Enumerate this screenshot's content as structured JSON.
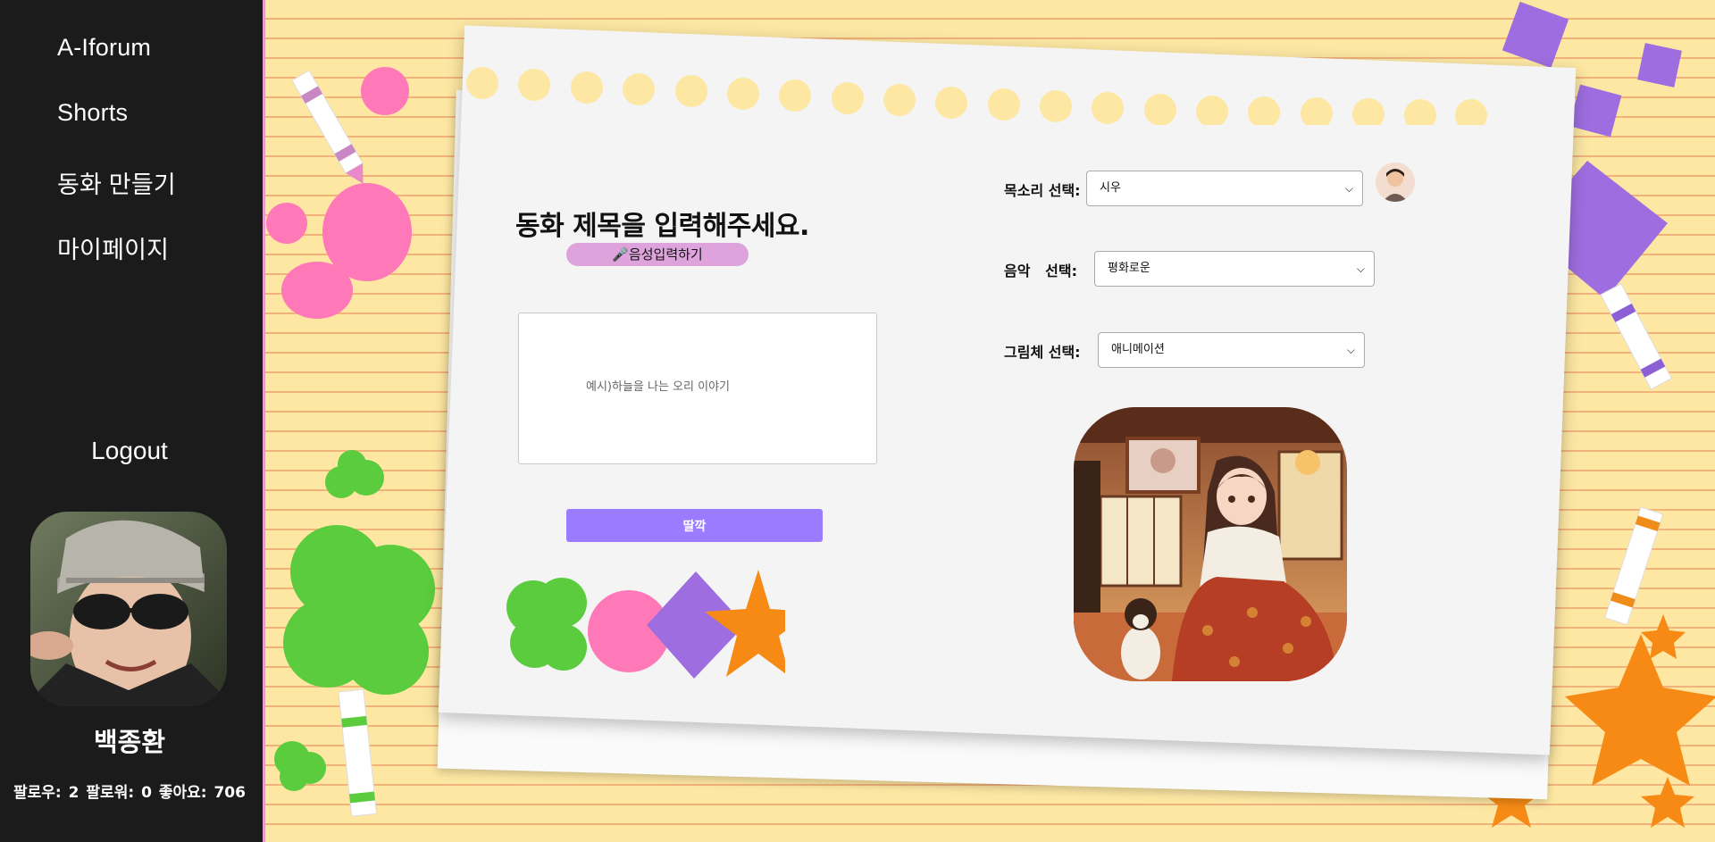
{
  "sidebar": {
    "nav": [
      {
        "label": "A-Iforum"
      },
      {
        "label": "Shorts"
      },
      {
        "label": "동화 만들기"
      },
      {
        "label": "마이페이지"
      }
    ],
    "logout_label": "Logout",
    "user": {
      "name": "백종환",
      "followers_label": "팔로우:",
      "followers": "2",
      "following_label": "팔로워:",
      "following": "0",
      "likes_label": "좋아요:",
      "likes": "706"
    }
  },
  "form": {
    "title_prompt": "동화 제목을 입력해주세요.",
    "voice_input_label": "🎤음성입력하기",
    "story_placeholder": "예시)하늘을 나는 오리 이야기",
    "submit_label": "딸깍",
    "voice": {
      "label": "목소리 선택:",
      "value": "시우"
    },
    "music": {
      "label": "음악   선택:",
      "value": "평화로운"
    },
    "style": {
      "label": "그림체 선택:",
      "value": "애니메이션"
    }
  },
  "colors": {
    "sidebar_bg": "#1b1b1b",
    "accent_purple": "#9b7bff",
    "voice_button": "#dea3dd",
    "paper_bg": "#fde7a3"
  }
}
